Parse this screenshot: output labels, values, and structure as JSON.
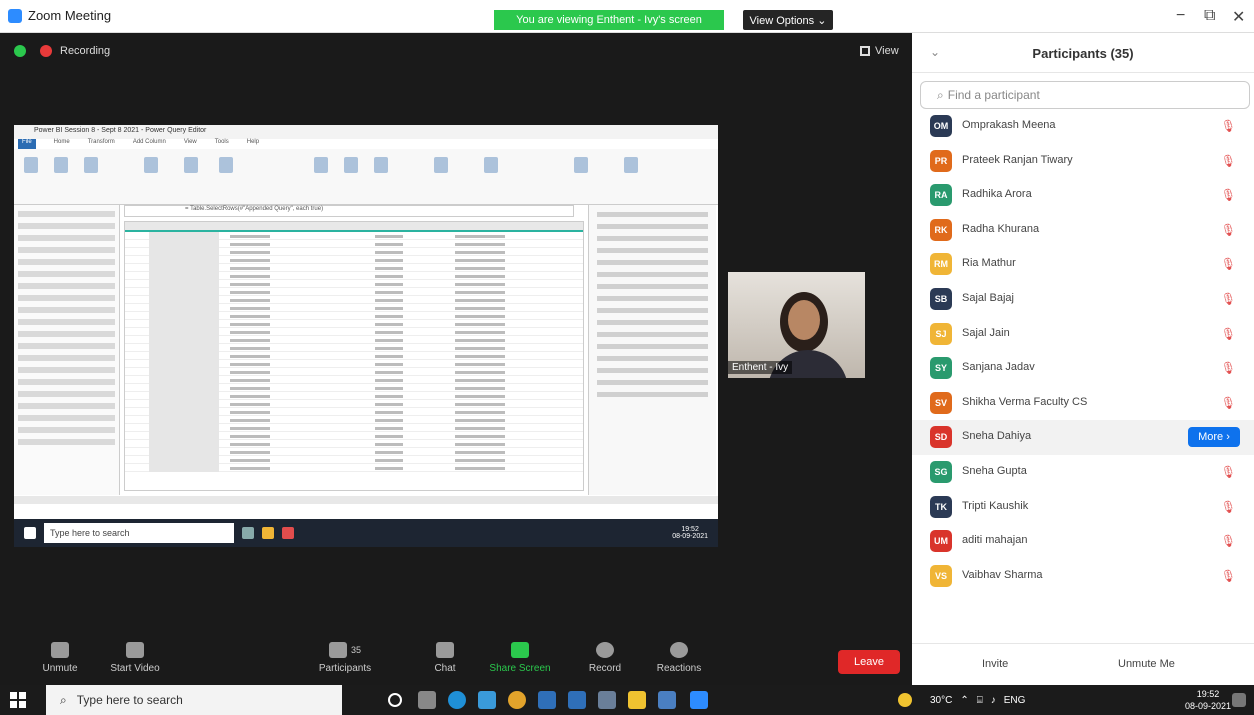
{
  "window": {
    "title": "Zoom Meeting",
    "share_banner": "You are viewing Enthent - Ivy's screen",
    "view_options": "View Options ⌄",
    "minimize": "−",
    "maximize": "⧉",
    "close": "✕"
  },
  "meeting": {
    "recording_label": "Recording",
    "view_label": "View",
    "camera_name": "Enthent - Ivy",
    "shared": {
      "title": "Power BI Session 8 - Sept 8 2021 - Power Query Editor",
      "tabs": [
        "File",
        "Home",
        "Transform",
        "Add Column",
        "View",
        "Tools",
        "Help"
      ],
      "formula": "= Table.SelectRows(#\"Appended Query\", each true)"
    },
    "inner_taskbar": {
      "search_placeholder": "Type here to search",
      "time": "19:52",
      "date": "08-09-2021"
    }
  },
  "toolbar": {
    "unmute": "Unmute",
    "start_video": "Start Video",
    "participants": "Participants",
    "participants_count": "35",
    "chat": "Chat",
    "share_screen": "Share Screen",
    "record": "Record",
    "reactions": "Reactions",
    "leave": "Leave"
  },
  "panel": {
    "title": "Participants (35)",
    "find_placeholder": "Find a participant",
    "more_label": "More ›",
    "invite": "Invite",
    "unmute_me": "Unmute Me",
    "participants": [
      {
        "initials": "OM",
        "name": "Omprakash Meena",
        "color": "#2b3a55"
      },
      {
        "initials": "PR",
        "name": "Prateek Ranjan Tiwary",
        "color": "#e06a1b"
      },
      {
        "initials": "RA",
        "name": "Radhika Arora",
        "color": "#2a9a6e"
      },
      {
        "initials": "RK",
        "name": "Radha Khurana",
        "color": "#e06a1b"
      },
      {
        "initials": "RM",
        "name": "Ria Mathur",
        "color": "#f0b536"
      },
      {
        "initials": "SB",
        "name": "Sajal Bajaj",
        "color": "#2b3a55"
      },
      {
        "initials": "SJ",
        "name": "Sajal Jain",
        "color": "#f0b536"
      },
      {
        "initials": "SY",
        "name": "Sanjana Jadav",
        "color": "#2a9a6e"
      },
      {
        "initials": "SV",
        "name": "Shikha Verma Faculty CS",
        "color": "#e06a1b"
      },
      {
        "initials": "SD",
        "name": "Sneha Dahiya",
        "color": "#d9342b",
        "highlight": true
      },
      {
        "initials": "SG",
        "name": "Sneha Gupta",
        "color": "#2a9a6e"
      },
      {
        "initials": "TK",
        "name": "Tripti Kaushik",
        "color": "#2b3a55"
      },
      {
        "initials": "UM",
        "name": "aditi mahajan",
        "color": "#d9342b"
      },
      {
        "initials": "VS",
        "name": "Vaibhav Sharma",
        "color": "#f0b536"
      }
    ]
  },
  "taskbar": {
    "search_placeholder": "Type here to search",
    "weather": "30°C",
    "lang": "ENG",
    "time": "19:52",
    "date": "08-09-2021"
  }
}
